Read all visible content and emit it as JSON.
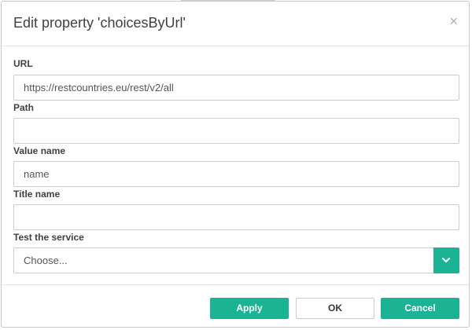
{
  "dialog": {
    "title": "Edit property 'choicesByUrl'",
    "close_glyph": "×"
  },
  "fields": {
    "url": {
      "label": "URL",
      "value": "https://restcountries.eu/rest/v2/all"
    },
    "path": {
      "label": "Path",
      "value": ""
    },
    "value_name": {
      "label": "Value name",
      "value": "name"
    },
    "title_name": {
      "label": "Title name",
      "value": ""
    },
    "test_service": {
      "label": "Test the service",
      "selected": "Choose..."
    }
  },
  "buttons": {
    "apply": "Apply",
    "ok": "OK",
    "cancel": "Cancel"
  },
  "colors": {
    "accent": "#1ab394",
    "border": "#cccccc",
    "text": "#404040"
  },
  "icons": {
    "close": "close-icon",
    "dropdown": "chevron-down-icon"
  }
}
